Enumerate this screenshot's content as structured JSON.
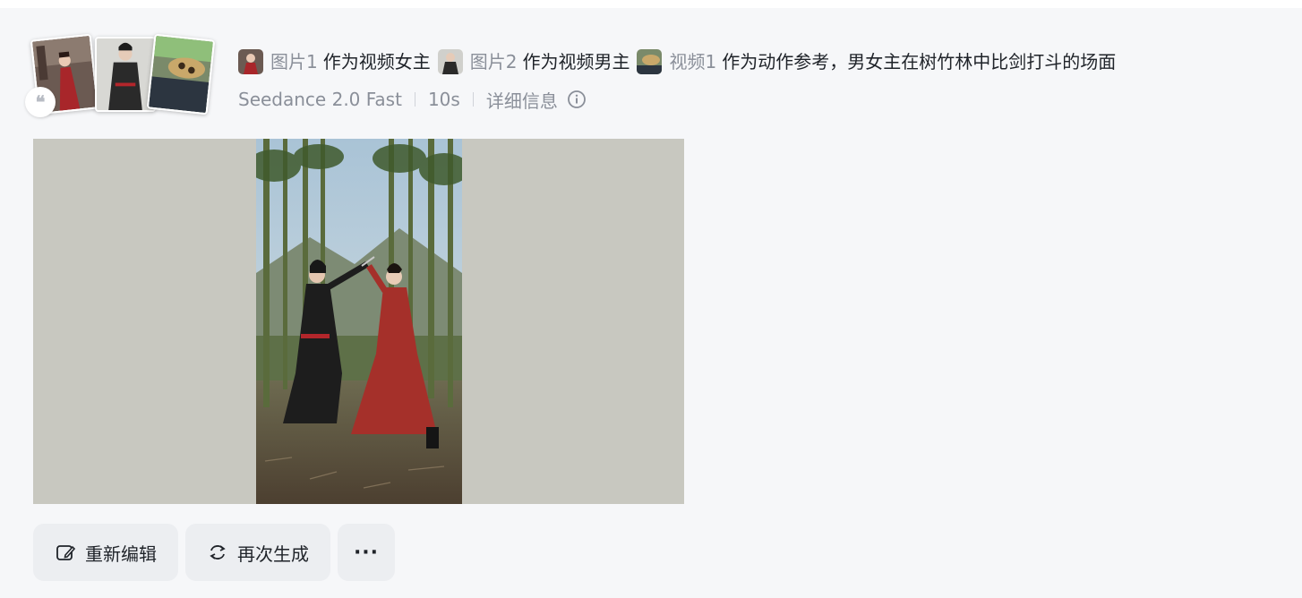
{
  "prompt": {
    "refs": [
      {
        "icon": "actress-thumb-icon",
        "label": "图片1",
        "text": "作为视频女主"
      },
      {
        "icon": "actor-thumb-icon",
        "label": "图片2",
        "text": "作为视频男主"
      },
      {
        "icon": "video-thumb-icon",
        "label": "视频1",
        "text": "作为动作参考，男女主在树竹林中比剑打斗的场面"
      }
    ]
  },
  "meta": {
    "model": "Seedance 2.0 Fast",
    "duration": "10s",
    "details_label": "详细信息"
  },
  "quote_glyph": "❝",
  "actions": {
    "reedit_label": "重新编辑",
    "regenerate_label": "再次生成",
    "more_label": "···"
  },
  "colors": {
    "background": "#f6f7f9",
    "muted_text": "#8a8f99",
    "button_bg": "#eceef1",
    "video_letterbox": "#c8c8c0"
  }
}
